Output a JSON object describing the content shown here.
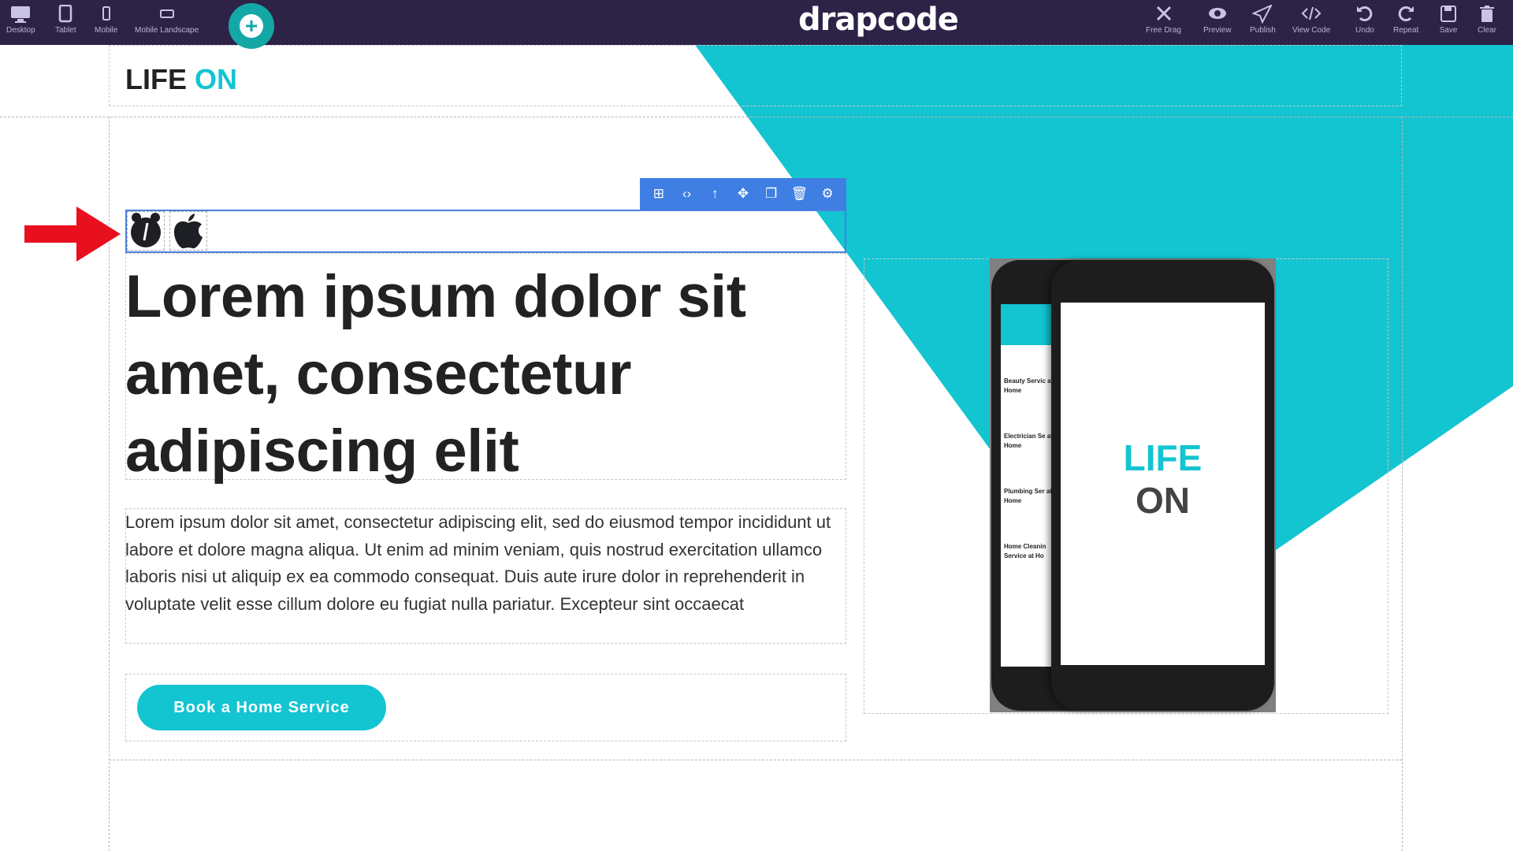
{
  "toolbar": {
    "left": [
      {
        "label": "Desktop",
        "icon": "desktop-icon"
      },
      {
        "label": "Tablet",
        "icon": "tablet-icon"
      },
      {
        "label": "Mobile",
        "icon": "mobile-icon"
      },
      {
        "label": "Mobile Landscape",
        "icon": "mobile-landscape-icon"
      }
    ],
    "add_icon": "+",
    "brand": "drapcode",
    "right": [
      {
        "label": "Free Drag",
        "icon": "free-drag-icon"
      },
      {
        "label": "Preview",
        "icon": "eye-icon"
      },
      {
        "label": "Publish",
        "icon": "paper-plane-icon"
      },
      {
        "label": "View Code",
        "icon": "code-icon"
      },
      {
        "label": "Undo",
        "icon": "undo-icon"
      },
      {
        "label": "Repeat",
        "icon": "redo-icon"
      },
      {
        "label": "Save",
        "icon": "save-icon"
      },
      {
        "label": "Clear",
        "icon": "trash-icon"
      }
    ]
  },
  "page": {
    "logo_part1": "LIFE",
    "logo_part2": "ON",
    "heading": "Lorem ipsum dolor sit amet, consectetur adipiscing elit",
    "paragraph": "Lorem ipsum dolor sit amet, consectetur adipiscing elit, sed do eiusmod tempor incididunt ut labore et dolore magna aliqua. Ut enim ad minim veniam, quis nostrud exercitation ullamco laboris nisi ut aliquip ex ea commodo consequat. Duis aute irure dolor in reprehenderit in voluptate velit esse cillum dolore eu fugiat nulla pariatur. Excepteur sint occaecat",
    "cta": "Book a Home Service",
    "phone_title1": "LIFE",
    "phone_title2": "ON",
    "phone_list": [
      "Beauty Servic at Home",
      "Electrician Se at Home",
      "Plumbing Ser at Home",
      "Home Cleanin Service at Ho"
    ]
  },
  "element_toolbar": [
    "add-icon",
    "code-icon",
    "arrow-up-icon",
    "move-icon",
    "copy-icon",
    "trash-icon",
    "gear-icon"
  ],
  "colors": {
    "topbar": "#2d2347",
    "accent": "#13c4d1",
    "selection": "#3f7ee3",
    "arrow": "#e8101e"
  }
}
